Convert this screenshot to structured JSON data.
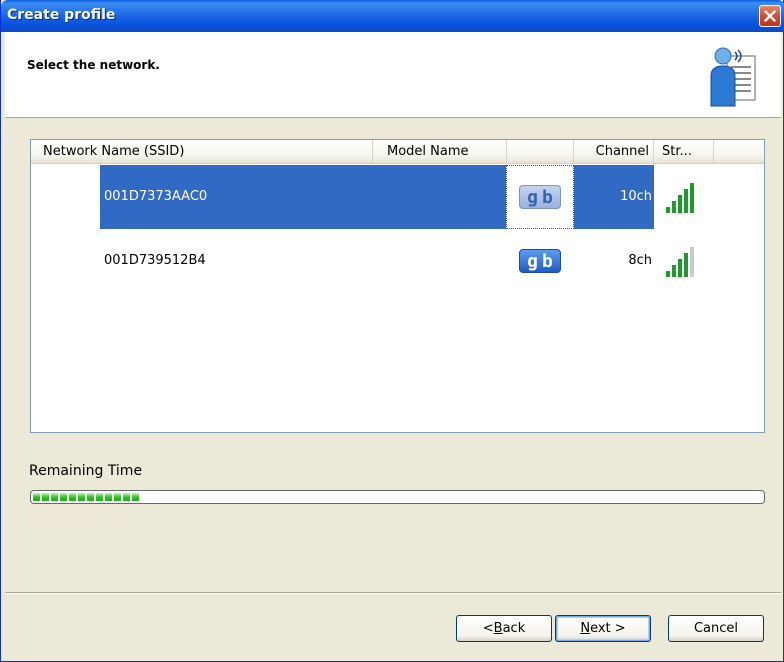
{
  "window": {
    "title": "Create profile"
  },
  "header": {
    "subtitle": "Select the network."
  },
  "list": {
    "columns": [
      "Network Name (SSID)",
      "Model Name",
      "",
      "Channel",
      "Str..."
    ],
    "rows": [
      {
        "ssid": "001D7373AAC0",
        "model": "",
        "badge": "gb",
        "channel": "10ch",
        "signal": 5,
        "selected": true
      },
      {
        "ssid": "001D739512B4",
        "model": "",
        "badge": "gb",
        "channel": "8ch",
        "signal": 4,
        "selected": false
      }
    ]
  },
  "progress": {
    "label": "Remaining Time",
    "segments": 12
  },
  "buttons": {
    "back": {
      "pre": "< ",
      "accel": "B",
      "post": "ack"
    },
    "next": {
      "pre": "",
      "accel": "N",
      "post": "ext >"
    },
    "cancel": "Cancel"
  },
  "colors": {
    "selection": "#316ac5",
    "titlebar": "#0a5fe0",
    "progress": "#2ec62a"
  },
  "icons": [
    "close-icon",
    "profile-wireless-icon",
    "signal-strength-icon"
  ]
}
